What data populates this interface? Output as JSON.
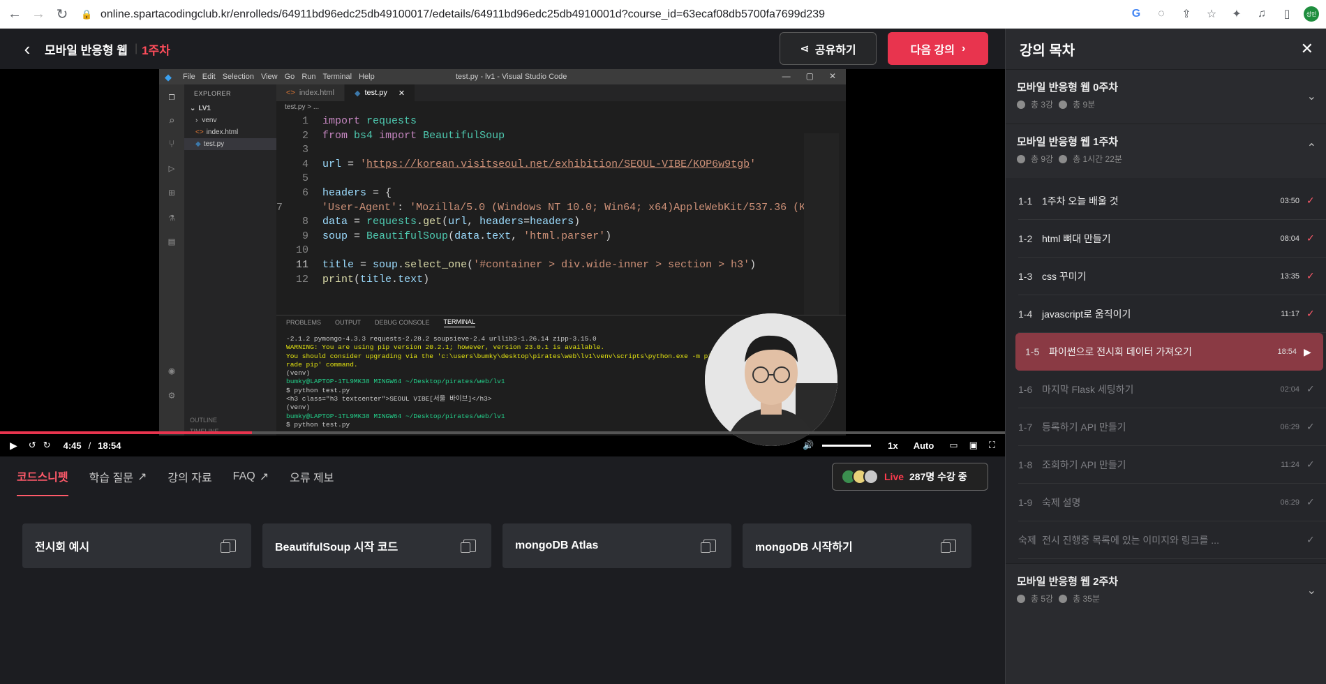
{
  "browser": {
    "url": "online.spartacodingclub.kr/enrolleds/64911bd96edc25db49100017/edetails/64911bd96edc25db4910001d?course_id=63ecaf08db5700fa7699d239",
    "profile_label": "성민"
  },
  "header": {
    "course_title": "모바일 반응형 웹",
    "week": "1주차",
    "share_label": "공유하기",
    "next_label": "다음 강의"
  },
  "video": {
    "vscode": {
      "window_title": "test.py - lv1 - Visual Studio Code",
      "menu": [
        "File",
        "Edit",
        "Selection",
        "View",
        "Go",
        "Run",
        "Terminal",
        "Help"
      ],
      "explorer_label": "EXPLORER",
      "tree": [
        "LV1",
        "venv",
        "index.html",
        "test.py"
      ],
      "tabs": [
        "index.html",
        "test.py"
      ],
      "breadcrumb": "test.py > ...",
      "panel_tabs": [
        "PROBLEMS",
        "OUTPUT",
        "DEBUG CONSOLE",
        "TERMINAL"
      ],
      "outline_label": "OUTLINE",
      "timeline_label": "TIMELINE",
      "terminal": [
        "-2.1.2 pymongo-4.3.3 requests-2.28.2 soupsieve-2.4 urllib3-1.26.14 zipp-3.15.0",
        "WARNING: You are using pip version 20.2.1; however, version 23.0.1 is available.",
        "You should consider upgrading via the 'c:\\users\\bumky\\desktop\\pirates\\web\\lv1\\venv\\scripts\\python.exe -m pi",
        "rade pip' command.",
        "(venv)",
        "bumky@LAPTOP-1TL9MK38 MINGW64 ~/Desktop/pirates/web/lv1",
        "$ python test.py",
        "<h3 class=\"h3 textcenter\">SEOUL VIBE[서울 바이브]</h3>",
        "(venv)",
        "bumky@LAPTOP-1TL9MK38 MINGW64 ~/Desktop/pirates/web/lv1",
        "$ python test.py"
      ]
    },
    "current_time": "4:45",
    "duration": "18:54",
    "progress": 0.251,
    "speed": "1x",
    "quality": "Auto"
  },
  "tabs": [
    {
      "label": "코드스니펫",
      "active": true
    },
    {
      "label": "학습 질문"
    },
    {
      "label": "강의 자료"
    },
    {
      "label": "FAQ"
    },
    {
      "label": "오류 제보"
    }
  ],
  "live": {
    "label": "Live",
    "text": "287명 수강 중"
  },
  "snippets": [
    "전시회 예시",
    "BeautifulSoup 시작 코드",
    "mongoDB Atlas",
    "mongoDB 시작하기"
  ],
  "sidebar": {
    "title": "강의 목차",
    "weeks": [
      {
        "title": "모바일 반응형 웹 0주차",
        "count": "총 3강",
        "time": "총 9분"
      },
      {
        "title": "모바일 반응형 웹 1주차",
        "count": "총 9강",
        "time": "총 1시간 22분"
      },
      {
        "title": "모바일 반응형 웹 2주차",
        "count": "총 5강",
        "time": "총 35분"
      }
    ],
    "lessons": [
      {
        "no": "1-1",
        "name": "1주차 오늘 배울 것",
        "dur": "03:50"
      },
      {
        "no": "1-2",
        "name": "html 뼈대 만들기",
        "dur": "08:04"
      },
      {
        "no": "1-3",
        "name": "css 꾸미기",
        "dur": "13:35"
      },
      {
        "no": "1-4",
        "name": "javascript로 움직이기",
        "dur": "11:17"
      },
      {
        "no": "1-5",
        "name": "파이썬으로 전시회 데이터 가져오기",
        "dur": "18:54"
      },
      {
        "no": "1-6",
        "name": "마지막 Flask 세팅하기",
        "dur": "02:04"
      },
      {
        "no": "1-7",
        "name": "등록하기 API 만들기",
        "dur": "06:29"
      },
      {
        "no": "1-8",
        "name": "조회하기 API 만들기",
        "dur": "11:24"
      },
      {
        "no": "1-9",
        "name": "숙제 설명",
        "dur": "06:29"
      },
      {
        "no": "숙제",
        "name": "전시 진행중 목록에 있는 이미지와 링크를 ...",
        "dur": ""
      }
    ]
  }
}
